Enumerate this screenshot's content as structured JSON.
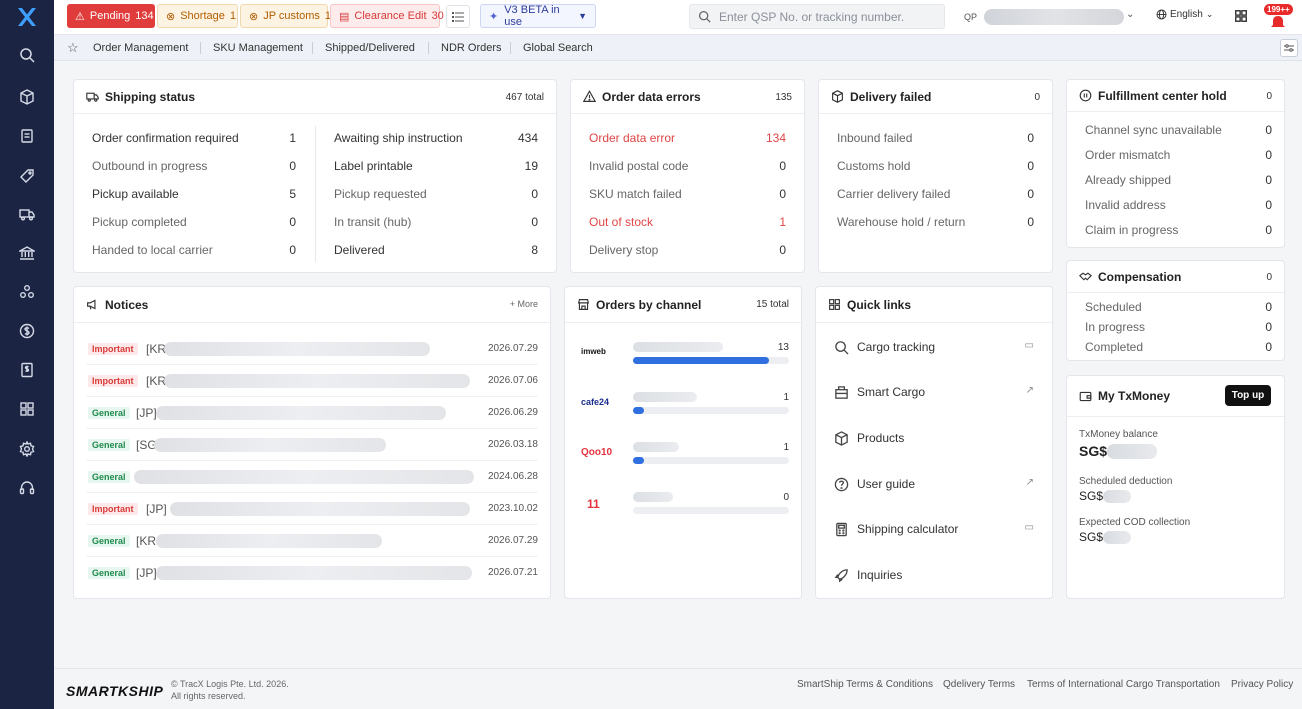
{
  "header": {
    "tags": [
      {
        "label": "Pending",
        "count": "134"
      },
      {
        "label": "Shortage",
        "count": "1"
      },
      {
        "label": "JP customs",
        "count": "1"
      },
      {
        "label": "Clearance Edit",
        "count": "30"
      }
    ],
    "beta_label": "V3 BETA in use",
    "search_placeholder": "Enter QSP No. or tracking number.",
    "account_prefix": "QP",
    "language": "English",
    "notification_badge": "199++"
  },
  "subnav": {
    "items": [
      "Order Management",
      "SKU Management",
      "Shipped/Delivered",
      "NDR Orders",
      "Global Search"
    ]
  },
  "shipping_status": {
    "title": "Shipping status",
    "total": "467 total",
    "left": [
      {
        "label": "Order confirmation required",
        "value": "1"
      },
      {
        "label": "Outbound in progress",
        "value": "0"
      },
      {
        "label": "Pickup available",
        "value": "5"
      },
      {
        "label": "Pickup completed",
        "value": "0"
      },
      {
        "label": "Handed to local carrier",
        "value": "0"
      }
    ],
    "right": [
      {
        "label": "Awaiting ship instruction",
        "value": "434"
      },
      {
        "label": "Label printable",
        "value": "19"
      },
      {
        "label": "Pickup requested",
        "value": "0"
      },
      {
        "label": "In transit (hub)",
        "value": "0"
      },
      {
        "label": "Delivered",
        "value": "8"
      }
    ]
  },
  "order_errors": {
    "title": "Order data errors",
    "total": "135",
    "rows": [
      {
        "label": "Order data error",
        "value": "134"
      },
      {
        "label": "Invalid postal code",
        "value": "0"
      },
      {
        "label": "SKU match failed",
        "value": "0"
      },
      {
        "label": "Out of stock",
        "value": "1"
      },
      {
        "label": "Delivery stop",
        "value": "0"
      }
    ]
  },
  "delivery_failed": {
    "title": "Delivery failed",
    "total": "0",
    "rows": [
      {
        "label": "Inbound failed",
        "value": "0"
      },
      {
        "label": "Customs hold",
        "value": "0"
      },
      {
        "label": "Carrier delivery failed",
        "value": "0"
      },
      {
        "label": "Warehouse hold / return",
        "value": "0"
      }
    ]
  },
  "fulfillment_hold": {
    "title": "Fulfillment center hold",
    "total": "0",
    "rows": [
      {
        "label": "Channel sync unavailable",
        "value": "0"
      },
      {
        "label": "Order mismatch",
        "value": "0"
      },
      {
        "label": "Already shipped",
        "value": "0"
      },
      {
        "label": "Invalid address",
        "value": "0"
      },
      {
        "label": "Claim in progress",
        "value": "0"
      }
    ]
  },
  "compensation": {
    "title": "Compensation",
    "total": "0",
    "rows": [
      {
        "label": "Scheduled",
        "value": "0"
      },
      {
        "label": "In progress",
        "value": "0"
      },
      {
        "label": "Completed",
        "value": "0"
      }
    ]
  },
  "notices": {
    "title": "Notices",
    "more": "+ More",
    "items": [
      {
        "tag": "Important",
        "prefix": "[KR",
        "date": "2026.07.29"
      },
      {
        "tag": "Important",
        "prefix": "[KR",
        "date": "2026.07.06"
      },
      {
        "tag": "General",
        "prefix": "[JP]",
        "date": "2026.06.29"
      },
      {
        "tag": "General",
        "prefix": "[SG",
        "date": "2026.03.18"
      },
      {
        "tag": "General",
        "prefix": "",
        "date": "2024.06.28"
      },
      {
        "tag": "Important",
        "prefix": "[JP]",
        "date": "2023.10.02"
      },
      {
        "tag": "General",
        "prefix": "[KR",
        "date": "2026.07.29"
      },
      {
        "tag": "General",
        "prefix": "[JP]",
        "date": "2026.07.21"
      }
    ]
  },
  "channels": {
    "title": "Orders by channel",
    "total": "15 total",
    "items": [
      {
        "logo": "imweb",
        "count": "13",
        "share": 0.87
      },
      {
        "logo": "cafe24",
        "count": "1",
        "share": 0.07
      },
      {
        "logo": "Qoo10",
        "count": "1",
        "share": 0.07
      },
      {
        "logo": "11",
        "count": "0",
        "share": 0
      }
    ]
  },
  "quick_links": {
    "title": "Quick links",
    "items": [
      "Cargo tracking",
      "Smart Cargo",
      "Products",
      "User guide",
      "Shipping calculator",
      "Inquiries"
    ]
  },
  "txmoney": {
    "title": "My TxMoney",
    "topup": "Top up",
    "balance_label": "TxMoney balance",
    "balance_prefix": "SG$",
    "deduction_label": "Scheduled deduction",
    "deduction_prefix": "SG$",
    "cod_label": "Expected COD collection",
    "cod_prefix": "SG$"
  },
  "footer": {
    "logo": "SMARTKSHIP",
    "copyright_1": "© TracX Logis Pte. Ltd. 2026.",
    "copyright_2": "All rights reserved.",
    "links": [
      "SmartShip Terms & Conditions",
      "Qdelivery Terms",
      "Terms of International Cargo Transportation",
      "Privacy Policy"
    ]
  },
  "colors": {
    "sidebar": "#1b2442",
    "accent": "#2f6fe0",
    "danger": "#e03c3c"
  }
}
